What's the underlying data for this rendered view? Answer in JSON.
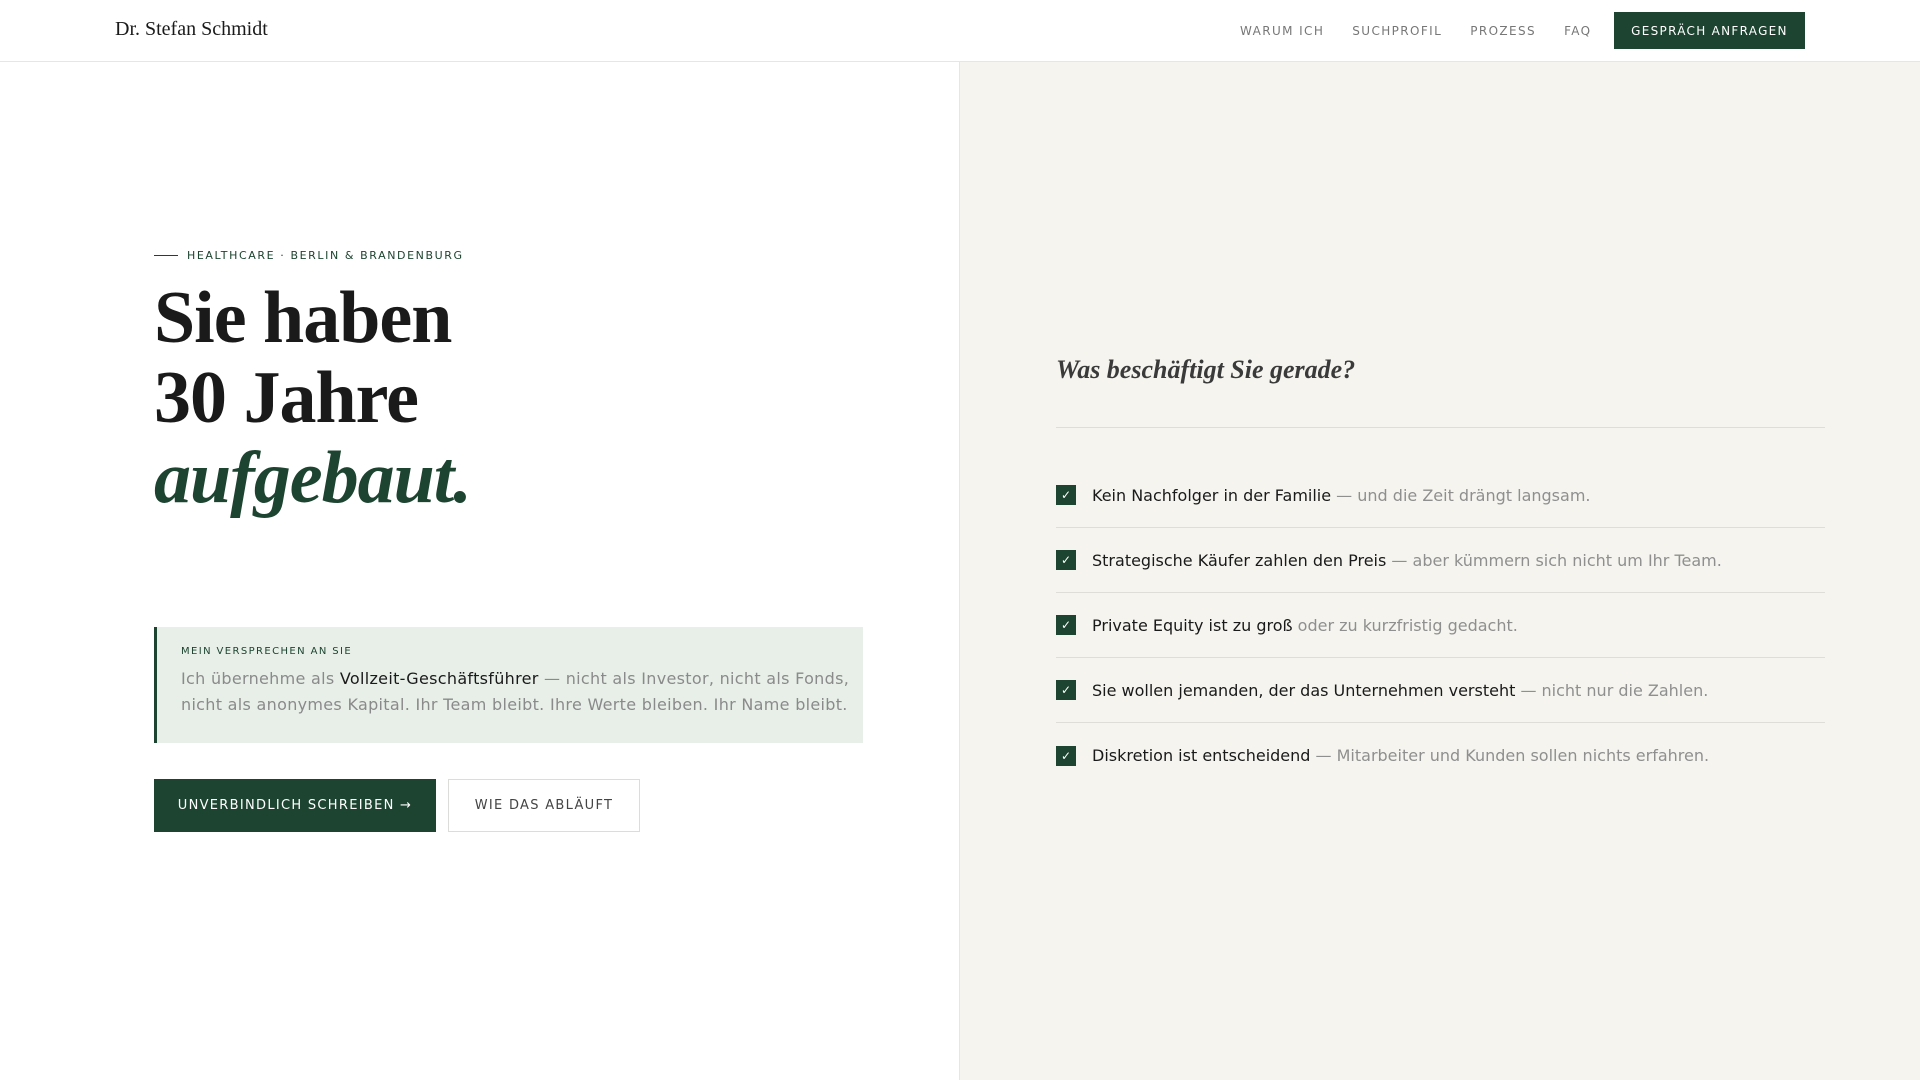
{
  "header": {
    "brand": "Dr. Stefan Schmidt",
    "nav": [
      "WARUM ICH",
      "SUCHPROFIL",
      "PROZESS",
      "FAQ"
    ],
    "cta": "GESPRÄCH ANFRAGEN"
  },
  "hero": {
    "eyebrow": "HEALTHCARE · BERLIN & BRANDENBURG",
    "headline_line1": "Sie haben",
    "headline_line2": "30 Jahre",
    "headline_line3": "aufgebaut.",
    "promise": {
      "label": "MEIN VERSPRECHEN AN SIE",
      "text_before": "Ich übernehme als ",
      "text_strong": "Vollzeit-Geschäftsführer",
      "text_after": " — nicht als Investor, nicht als Fonds, nicht als anonymes Kapital. Ihr Team bleibt. Ihre Werte bleiben. Ihr Name bleibt."
    },
    "primary_button": "UNVERBINDLICH SCHREIBEN →",
    "secondary_button": "WIE DAS ABLÄUFT"
  },
  "concerns": {
    "question": "Was beschäftigt Sie gerade?",
    "check_glyph": "✓",
    "items": [
      {
        "strong": "Kein Nachfolger in der Familie",
        "muted": " — und die Zeit drängt langsam."
      },
      {
        "strong": "Strategische Käufer zahlen den Preis",
        "muted": " — aber kümmern sich nicht um Ihr Team."
      },
      {
        "strong": "Private Equity ist zu groß",
        "muted": " oder zu kurzfristig gedacht."
      },
      {
        "strong": "Sie wollen jemanden, der das Unternehmen versteht",
        "muted": " — nicht nur die Zahlen."
      },
      {
        "strong": "Diskretion ist entscheidend",
        "muted": " — Mitarbeiter und Kunden sollen nichts erfahren."
      }
    ]
  },
  "colors": {
    "accent": "#1d4430",
    "promise_bg": "#e7efe8",
    "right_bg": "#f5f4ef"
  }
}
